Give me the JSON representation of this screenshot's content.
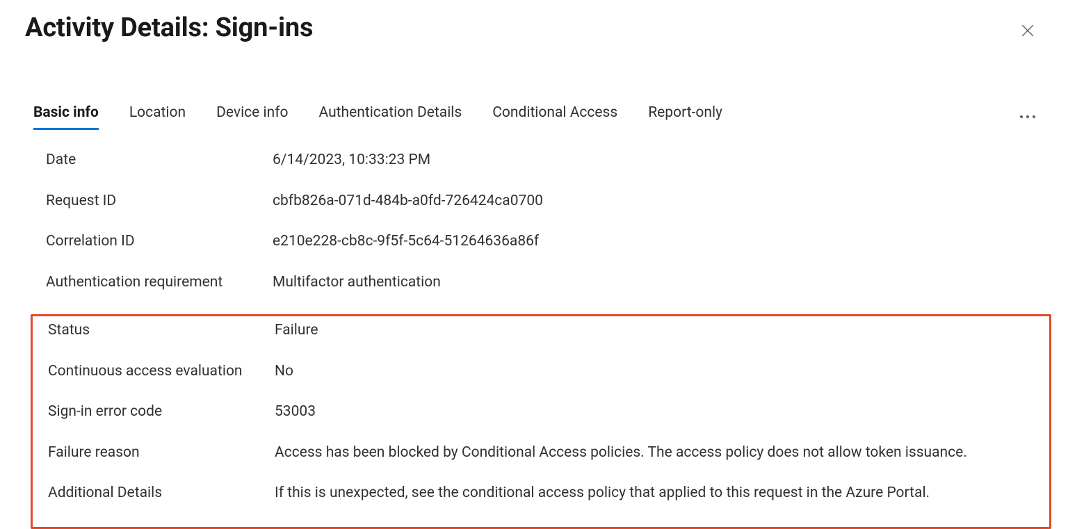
{
  "title": "Activity Details: Sign-ins",
  "tabs": [
    {
      "label": "Basic info",
      "active": true
    },
    {
      "label": "Location",
      "active": false
    },
    {
      "label": "Device info",
      "active": false
    },
    {
      "label": "Authentication Details",
      "active": false
    },
    {
      "label": "Conditional Access",
      "active": false
    },
    {
      "label": "Report-only",
      "active": false
    }
  ],
  "fields": {
    "date": {
      "label": "Date",
      "value": "6/14/2023, 10:33:23 PM"
    },
    "request_id": {
      "label": "Request ID",
      "value": "cbfb826a-071d-484b-a0fd-726424ca0700"
    },
    "correlation": {
      "label": "Correlation ID",
      "value": "e210e228-cb8c-9f5f-5c64-51264636a86f"
    },
    "auth_req": {
      "label": "Authentication requirement",
      "value": "Multifactor authentication"
    },
    "status": {
      "label": "Status",
      "value": "Failure"
    },
    "cae": {
      "label": "Continuous access evaluation",
      "value": "No"
    },
    "err_code": {
      "label": "Sign-in error code",
      "value": "53003"
    },
    "fail_reason": {
      "label": "Failure reason",
      "value": "Access has been blocked by Conditional Access policies. The access policy does not allow token issuance."
    },
    "add_details": {
      "label": "Additional Details",
      "value": "If this is unexpected, see the conditional access policy that applied to this request in the Azure Portal."
    }
  }
}
